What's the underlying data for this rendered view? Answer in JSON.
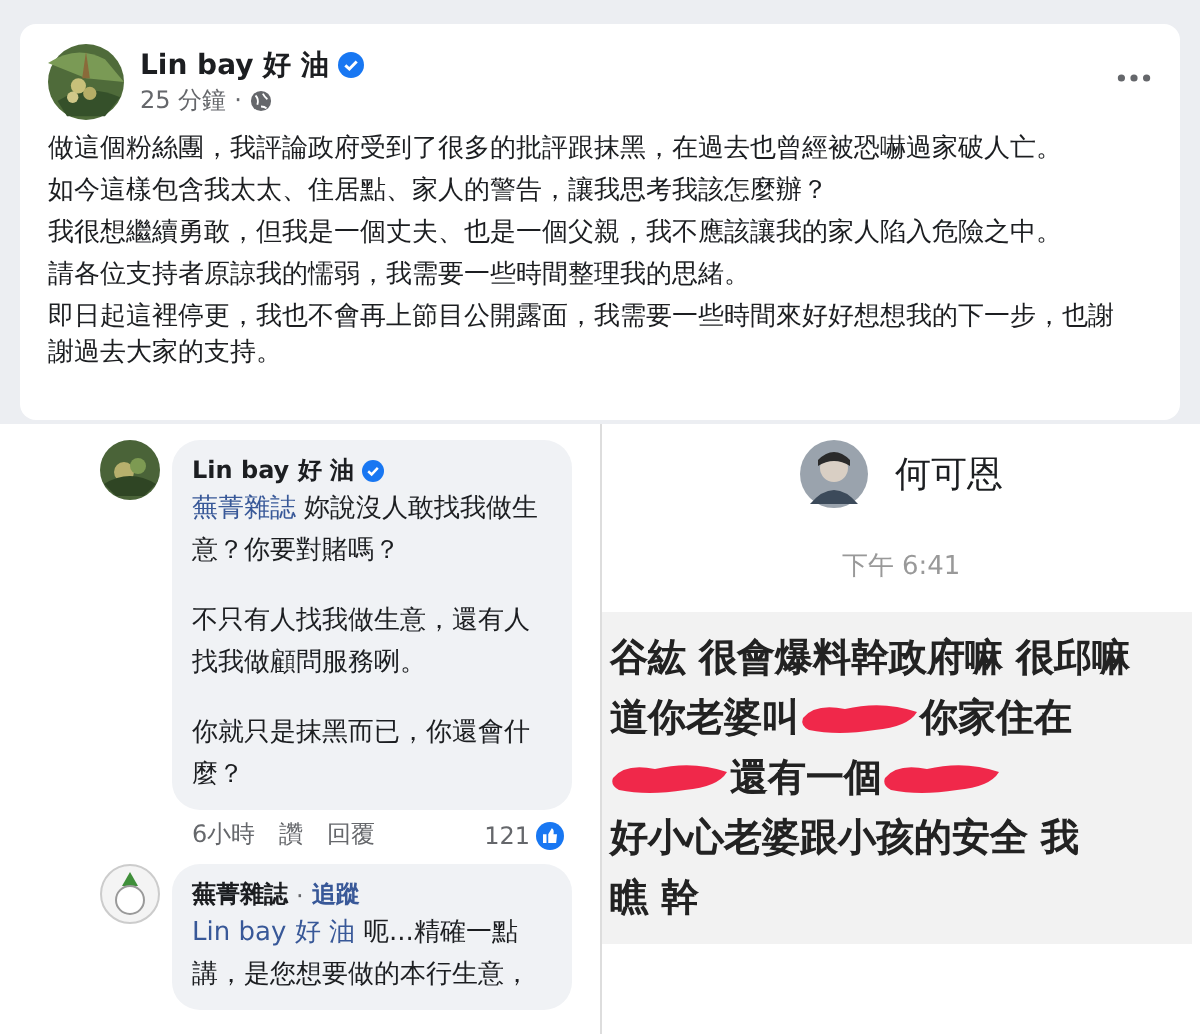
{
  "post": {
    "author": "Lin bay 好 油",
    "verified": true,
    "time": "25 分鐘",
    "time_separator": "·",
    "paragraphs": [
      "做這個粉絲團，我評論政府受到了很多的批評跟抹黑，在過去也曾經被恐嚇過家破人亡。",
      "如今這樣包含我太太、住居點、家人的警告，讓我思考我該怎麼辦？",
      "我很想繼續勇敢，但我是一個丈夫、也是一個父親，我不應該讓我的家人陷入危險之中。",
      "請各位支持者原諒我的懦弱，我需要一些時間整理我的思緒。",
      "即日起這裡停更，我也不會再上節目公開露面，我需要一些時間來好好想想我的下一步，也謝謝過去大家的支持。"
    ]
  },
  "comments": [
    {
      "author": "Lin bay 好 油",
      "verified": true,
      "mention": "蕪菁雜誌",
      "paragraphs": [
        "妳說沒人敢找我做生意？你要對賭嗎？",
        "不只有人找我做生意，還有人找我做顧問服務咧。",
        "你就只是抹黑而已，你還會什麼？"
      ],
      "time": "6小時",
      "actions": [
        "讚",
        "回覆"
      ],
      "reactions": "121"
    },
    {
      "author": "蕪菁雜誌",
      "verified": false,
      "follow_separator": "·",
      "follow": "追蹤",
      "mention": "Lin bay 好 油",
      "paragraphs": [
        "呃...精確一點講，是您想要做的本行生意，"
      ]
    }
  ],
  "chat_screenshot": {
    "contact_name": "何可恩",
    "time": "下午 6:41",
    "lines": [
      [
        {
          "kind": "text",
          "text": "谷紘 很會爆料幹政府嘛 很邱嘛"
        }
      ],
      [
        {
          "kind": "text",
          "text": "道你老婆叫"
        },
        {
          "kind": "redaction"
        },
        {
          "kind": "text",
          "text": "你家住在"
        }
      ],
      [
        {
          "kind": "redaction"
        },
        {
          "kind": "text",
          "text": "還有一個"
        },
        {
          "kind": "redaction"
        }
      ],
      [
        {
          "kind": "text",
          "text": "好小心老婆跟小孩的安全 我"
        }
      ],
      [
        {
          "kind": "text",
          "text": "瞧 幹"
        }
      ]
    ]
  }
}
